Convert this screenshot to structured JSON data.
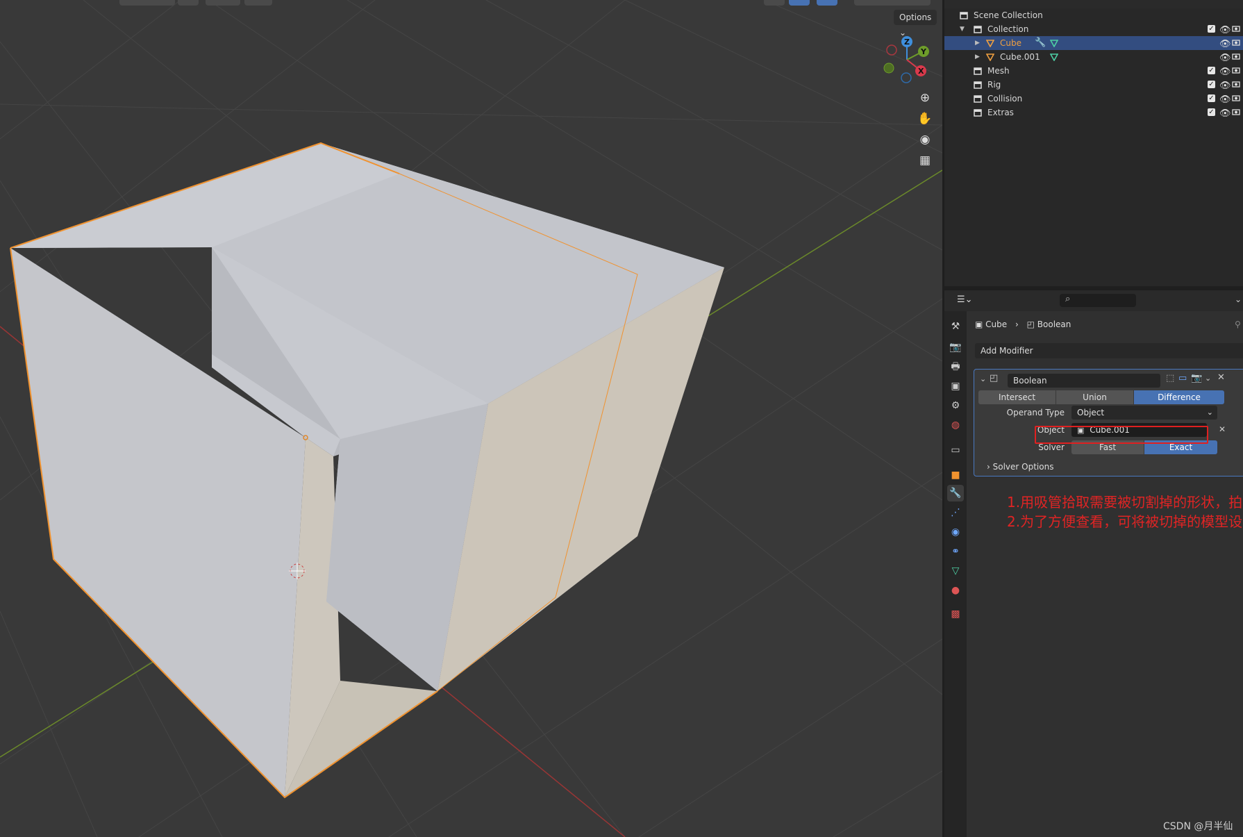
{
  "viewport": {
    "options_label": "Options",
    "gizmo": {
      "z": "Z",
      "y": "Y",
      "x": "X"
    },
    "nav_icons": [
      "zoom-icon",
      "hand-icon",
      "camera-icon",
      "grid-icon"
    ]
  },
  "outliner": {
    "items": [
      {
        "label": "Scene Collection",
        "icon": "scene-collection-icon"
      },
      {
        "label": "Collection",
        "icon": "collection-icon"
      },
      {
        "label": "Cube",
        "icon": "mesh-object-icon",
        "selected": true
      },
      {
        "label": "Cube.001",
        "icon": "mesh-object-icon"
      },
      {
        "label": "Mesh",
        "icon": "collection-icon"
      },
      {
        "label": "Rig",
        "icon": "collection-icon"
      },
      {
        "label": "Collision",
        "icon": "collection-icon"
      },
      {
        "label": "Extras",
        "icon": "collection-icon"
      }
    ]
  },
  "properties": {
    "breadcrumb": {
      "object": "Cube",
      "modifier": "Boolean"
    },
    "add_modifier": "Add Modifier",
    "modifier": {
      "name": "Boolean",
      "ops": [
        "Intersect",
        "Union",
        "Difference"
      ],
      "active_op": "Difference",
      "operand_type_label": "Operand Type",
      "operand_type_value": "Object",
      "object_label": "Object",
      "object_value": "Cube.001",
      "solver_label": "Solver",
      "solver_options": [
        "Fast",
        "Exact"
      ],
      "active_solver": "Exact",
      "solver_options_label": "Solver Options"
    },
    "annotations": [
      "1.用吸管拾取需要被切割掉的形状，拍",
      "2.为了方便查看，可将被切掉的模型设"
    ]
  },
  "watermark": "CSDN @月半仙",
  "colors": {
    "selection": "#334d80",
    "accent": "#4772b3",
    "outline": "#f0922f",
    "highlight_box": "#e02020",
    "annotation": "#e02424"
  }
}
